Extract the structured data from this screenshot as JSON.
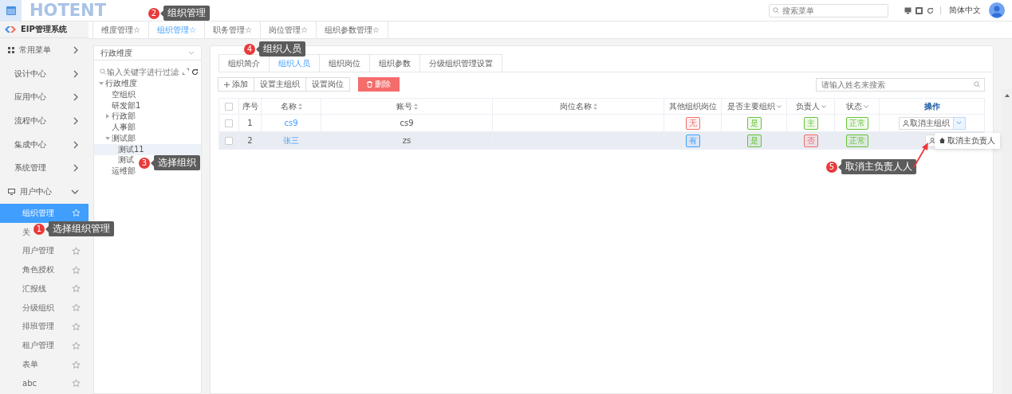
{
  "header": {
    "logo": "HOTENT",
    "search": {
      "placeholder": "搜索菜单"
    },
    "language": "简体中文"
  },
  "sidebar": {
    "title": "EIP管理系统",
    "groups": [
      {
        "label": "常用菜单",
        "expanded": false
      },
      {
        "label": "设计中心",
        "expanded": false
      },
      {
        "label": "应用中心",
        "expanded": false
      },
      {
        "label": "流程中心",
        "expanded": false
      },
      {
        "label": "集成中心",
        "expanded": false
      },
      {
        "label": "系统管理",
        "expanded": false
      },
      {
        "label": "用户中心",
        "expanded": true
      }
    ],
    "items": [
      {
        "label": "组织管理",
        "selected": true
      },
      {
        "label": "关",
        "selected": false
      },
      {
        "label": "用户管理",
        "selected": false
      },
      {
        "label": "角色授权",
        "selected": false
      },
      {
        "label": "汇报线",
        "selected": false
      },
      {
        "label": "分级组织",
        "selected": false
      },
      {
        "label": "排班管理",
        "selected": false
      },
      {
        "label": "租户管理",
        "selected": false
      },
      {
        "label": "表单",
        "selected": false
      },
      {
        "label": "abc",
        "selected": false
      }
    ]
  },
  "tabs": [
    {
      "label": "维度管理☆",
      "selected": false
    },
    {
      "label": "组织管理☆",
      "selected": true
    },
    {
      "label": "职务管理☆",
      "selected": false
    },
    {
      "label": "岗位管理☆",
      "selected": false
    },
    {
      "label": "组织参数管理☆",
      "selected": false
    }
  ],
  "tree": {
    "dimension": "行政维度",
    "filter_placeholder": "输入关键字进行过滤",
    "nodes": [
      {
        "label": "行政维度",
        "expanded": true,
        "selected": false,
        "children": [
          {
            "label": "空组织",
            "selected": false
          },
          {
            "label": "研发部1",
            "selected": false
          },
          {
            "label": "行政部",
            "expanded": false,
            "selected": false
          },
          {
            "label": "人事部",
            "selected": false
          },
          {
            "label": "测试部",
            "expanded": true,
            "selected": false,
            "children": [
              {
                "label": "测试11",
                "selected": true
              },
              {
                "label": "测试",
                "selected": false
              }
            ]
          },
          {
            "label": "运维部",
            "selected": false
          }
        ]
      }
    ]
  },
  "subtabs": [
    {
      "label": "组织简介",
      "selected": false
    },
    {
      "label": "组织人员",
      "selected": true
    },
    {
      "label": "组织岗位",
      "selected": false
    },
    {
      "label": "组织参数",
      "selected": false
    },
    {
      "label": "分级组织管理设置",
      "selected": false
    }
  ],
  "toolbar": [
    {
      "label": "添加",
      "kind": "add"
    },
    {
      "label": "设置主组织",
      "kind": "plain"
    },
    {
      "label": "设置岗位",
      "kind": "plain"
    },
    {
      "label": "删除",
      "kind": "danger"
    }
  ],
  "search": {
    "placeholder": "请输入姓名来搜索"
  },
  "table": {
    "all_checked": false,
    "columns": [
      {
        "label": "序号",
        "kind": "plain"
      },
      {
        "label": "名称",
        "kind": "sort"
      },
      {
        "label": "账号",
        "kind": "sort"
      },
      {
        "label": "岗位名称",
        "kind": "sort"
      },
      {
        "label": "其他组织岗位",
        "kind": "plain"
      },
      {
        "label": "是否主要组织",
        "kind": "filter"
      },
      {
        "label": "负责人",
        "kind": "filter"
      },
      {
        "label": "状态",
        "kind": "filter"
      },
      {
        "label": "操作",
        "kind": "head"
      }
    ],
    "rows": [
      {
        "checked": false,
        "highlighted": false,
        "index": "1",
        "name": "cs9",
        "account": "cs9",
        "tags": [
          {
            "text": "无",
            "color": "#f56c6c"
          },
          {
            "text": "是",
            "color": "#67c23a"
          },
          {
            "text": "主",
            "color": "#67c23a"
          },
          {
            "text": "正常",
            "color": "#67c23a"
          }
        ],
        "action": "取消主组织"
      },
      {
        "checked": false,
        "highlighted": true,
        "index": "2",
        "name": "张三",
        "account": "zs",
        "tags": [
          {
            "text": "有",
            "color": "#409eff"
          },
          {
            "text": "是",
            "color": "#67c23a"
          },
          {
            "text": "否",
            "color": "#f56c6c"
          },
          {
            "text": "正常",
            "color": "#67c23a"
          }
        ],
        "menu": "取消主负责人"
      }
    ]
  },
  "callouts": [
    {
      "number": "1",
      "text": "选择组织管理"
    },
    {
      "number": "2",
      "text": "组织管理"
    },
    {
      "number": "3",
      "text": "选择组织"
    },
    {
      "number": "4",
      "text": "组织人员"
    },
    {
      "number": "5",
      "text": "取消主负责人人"
    }
  ]
}
